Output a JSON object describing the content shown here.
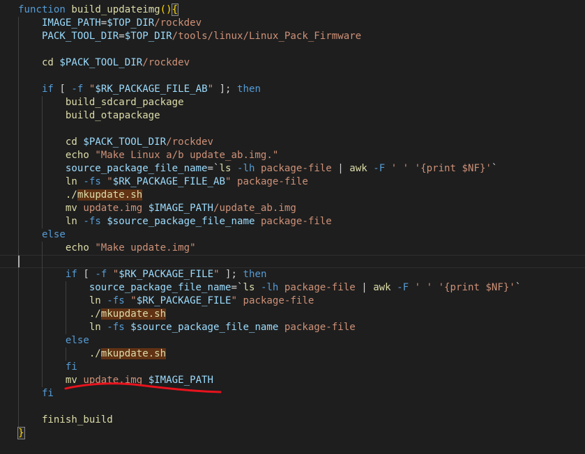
{
  "colors": {
    "background": "#1e1e1e",
    "keyword": "#569cd6",
    "function_name": "#dcdcaa",
    "variable": "#9cdcfe",
    "string": "#ce9178",
    "plain": "#d4d4d4",
    "option": "#569cd6",
    "annotation": "#e8131d",
    "highlight_bg": "#613214"
  },
  "code_lines": [
    {
      "tokens": [
        {
          "t": "function",
          "c": "keyword"
        },
        {
          "t": " ",
          "c": "plain"
        },
        {
          "t": "build_updateimg",
          "c": "function_name"
        },
        {
          "t": "(",
          "c": "brace"
        },
        {
          "t": ")",
          "c": "brace"
        },
        {
          "t": "{",
          "c": "brace_match"
        }
      ]
    },
    {
      "tokens": [
        {
          "t": "    IMAGE_PATH",
          "c": "variable"
        },
        {
          "t": "=",
          "c": "plain"
        },
        {
          "t": "$TOP_DIR",
          "c": "variable"
        },
        {
          "t": "/rockdev",
          "c": "string"
        }
      ]
    },
    {
      "tokens": [
        {
          "t": "    PACK_TOOL_DIR",
          "c": "variable"
        },
        {
          "t": "=",
          "c": "plain"
        },
        {
          "t": "$TOP_DIR",
          "c": "variable"
        },
        {
          "t": "/tools/linux/Linux_Pack_Firmware",
          "c": "string"
        }
      ]
    },
    {
      "tokens": []
    },
    {
      "tokens": [
        {
          "t": "    cd ",
          "c": "function_name"
        },
        {
          "t": "$PACK_TOOL_DIR",
          "c": "variable"
        },
        {
          "t": "/rockdev",
          "c": "string"
        }
      ]
    },
    {
      "tokens": []
    },
    {
      "tokens": [
        {
          "t": "    if",
          "c": "keyword"
        },
        {
          "t": " [ ",
          "c": "plain"
        },
        {
          "t": "-f",
          "c": "option"
        },
        {
          "t": " \"",
          "c": "string"
        },
        {
          "t": "$RK_PACKAGE_FILE_AB",
          "c": "variable"
        },
        {
          "t": "\"",
          "c": "string"
        },
        {
          "t": " ]; ",
          "c": "plain"
        },
        {
          "t": "then",
          "c": "keyword"
        }
      ]
    },
    {
      "tokens": [
        {
          "t": "        build_sdcard_package",
          "c": "function_name"
        }
      ]
    },
    {
      "tokens": [
        {
          "t": "        build_otapackage",
          "c": "function_name"
        }
      ]
    },
    {
      "tokens": []
    },
    {
      "tokens": [
        {
          "t": "        cd ",
          "c": "function_name"
        },
        {
          "t": "$PACK_TOOL_DIR",
          "c": "variable"
        },
        {
          "t": "/rockdev",
          "c": "string"
        }
      ]
    },
    {
      "tokens": [
        {
          "t": "        echo ",
          "c": "function_name"
        },
        {
          "t": "\"Make Linux a/b update_ab.img.\"",
          "c": "string"
        }
      ]
    },
    {
      "tokens": [
        {
          "t": "        source_package_file_name",
          "c": "variable"
        },
        {
          "t": "=`",
          "c": "plain"
        },
        {
          "t": "ls",
          "c": "function_name"
        },
        {
          "t": " ",
          "c": "plain"
        },
        {
          "t": "-lh",
          "c": "option"
        },
        {
          "t": " package-file",
          "c": "string"
        },
        {
          "t": " | ",
          "c": "plain"
        },
        {
          "t": "awk",
          "c": "function_name"
        },
        {
          "t": " ",
          "c": "plain"
        },
        {
          "t": "-F",
          "c": "option"
        },
        {
          "t": " ' ' '{print $NF}'",
          "c": "string"
        },
        {
          "t": "`",
          "c": "plain"
        }
      ]
    },
    {
      "tokens": [
        {
          "t": "        ln ",
          "c": "function_name"
        },
        {
          "t": "-fs",
          "c": "option"
        },
        {
          "t": " \"",
          "c": "string"
        },
        {
          "t": "$RK_PACKAGE_FILE_AB",
          "c": "variable"
        },
        {
          "t": "\"",
          "c": "string"
        },
        {
          "t": " package-file",
          "c": "string"
        }
      ]
    },
    {
      "tokens": [
        {
          "t": "        ./",
          "c": "function_name"
        },
        {
          "t": "mkupdate.sh",
          "c": "function_name_hl"
        }
      ]
    },
    {
      "tokens": [
        {
          "t": "        mv ",
          "c": "function_name"
        },
        {
          "t": "update.img ",
          "c": "string"
        },
        {
          "t": "$IMAGE_PATH",
          "c": "variable"
        },
        {
          "t": "/update_ab.img",
          "c": "string"
        }
      ]
    },
    {
      "tokens": [
        {
          "t": "        ln ",
          "c": "function_name"
        },
        {
          "t": "-fs",
          "c": "option"
        },
        {
          "t": " ",
          "c": "plain"
        },
        {
          "t": "$source_package_file_name",
          "c": "variable"
        },
        {
          "t": " package-file",
          "c": "string"
        }
      ]
    },
    {
      "tokens": [
        {
          "t": "    else",
          "c": "keyword"
        }
      ]
    },
    {
      "tokens": [
        {
          "t": "        echo ",
          "c": "function_name"
        },
        {
          "t": "\"Make update.img\"",
          "c": "string"
        }
      ]
    },
    {
      "tokens": []
    },
    {
      "tokens": [
        {
          "t": "        if",
          "c": "keyword"
        },
        {
          "t": " [ ",
          "c": "plain"
        },
        {
          "t": "-f",
          "c": "option"
        },
        {
          "t": " \"",
          "c": "string"
        },
        {
          "t": "$RK_PACKAGE_FILE",
          "c": "variable"
        },
        {
          "t": "\"",
          "c": "string"
        },
        {
          "t": " ]; ",
          "c": "plain"
        },
        {
          "t": "then",
          "c": "keyword"
        }
      ]
    },
    {
      "tokens": [
        {
          "t": "            source_package_file_name",
          "c": "variable"
        },
        {
          "t": "=`",
          "c": "plain"
        },
        {
          "t": "ls",
          "c": "function_name"
        },
        {
          "t": " ",
          "c": "plain"
        },
        {
          "t": "-lh",
          "c": "option"
        },
        {
          "t": " package-file",
          "c": "string"
        },
        {
          "t": " | ",
          "c": "plain"
        },
        {
          "t": "awk",
          "c": "function_name"
        },
        {
          "t": " ",
          "c": "plain"
        },
        {
          "t": "-F",
          "c": "option"
        },
        {
          "t": " ' ' '{print $NF}'",
          "c": "string"
        },
        {
          "t": "`",
          "c": "plain"
        }
      ]
    },
    {
      "tokens": [
        {
          "t": "            ln ",
          "c": "function_name"
        },
        {
          "t": "-fs",
          "c": "option"
        },
        {
          "t": " \"",
          "c": "string"
        },
        {
          "t": "$RK_PACKAGE_FILE",
          "c": "variable"
        },
        {
          "t": "\"",
          "c": "string"
        },
        {
          "t": " package-file",
          "c": "string"
        }
      ]
    },
    {
      "tokens": [
        {
          "t": "            ./",
          "c": "function_name"
        },
        {
          "t": "mkupdate.sh",
          "c": "function_name_hl"
        }
      ]
    },
    {
      "tokens": [
        {
          "t": "            ln ",
          "c": "function_name"
        },
        {
          "t": "-fs",
          "c": "option"
        },
        {
          "t": " ",
          "c": "plain"
        },
        {
          "t": "$source_package_file_name",
          "c": "variable"
        },
        {
          "t": " package-file",
          "c": "string"
        }
      ]
    },
    {
      "tokens": [
        {
          "t": "        else",
          "c": "keyword"
        }
      ]
    },
    {
      "tokens": [
        {
          "t": "            ./",
          "c": "function_name"
        },
        {
          "t": "mkupdate.sh",
          "c": "function_name_hl"
        }
      ]
    },
    {
      "tokens": [
        {
          "t": "        fi",
          "c": "keyword"
        }
      ]
    },
    {
      "tokens": [
        {
          "t": "        mv ",
          "c": "function_name"
        },
        {
          "t": "update.img ",
          "c": "string"
        },
        {
          "t": "$IMAGE_PATH",
          "c": "variable"
        }
      ]
    },
    {
      "tokens": [
        {
          "t": "    fi",
          "c": "keyword"
        }
      ]
    },
    {
      "tokens": []
    },
    {
      "tokens": [
        {
          "t": "    finish_build",
          "c": "function_name"
        }
      ]
    },
    {
      "tokens": [
        {
          "t": "}",
          "c": "brace_match"
        }
      ]
    }
  ]
}
